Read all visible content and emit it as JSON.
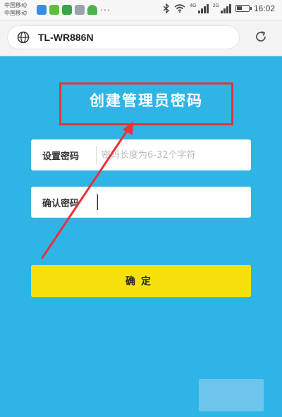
{
  "status_bar": {
    "carrier_line1": "中国移动",
    "carrier_line2": "中国移动",
    "network_4g": "4G",
    "network_2g": "2G",
    "time": "16:02",
    "battery_level": 0.45
  },
  "browser": {
    "url": "TL-WR886N"
  },
  "page": {
    "title": "创建管理员密码",
    "password_label": "设置密码",
    "password_placeholder": "密码长度为6-32个字符",
    "confirm_label": "确认密码",
    "confirm_value": "",
    "submit_label": "确定"
  },
  "annotation": {
    "highlight_color": "#e8323c"
  }
}
